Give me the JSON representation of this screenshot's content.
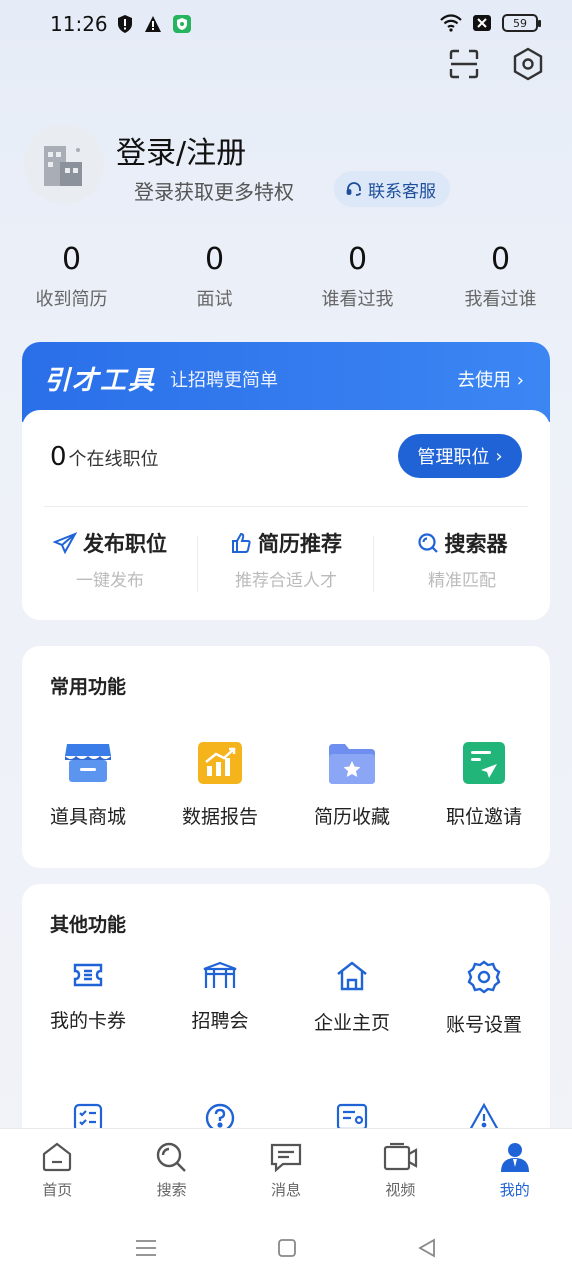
{
  "status_bar": {
    "time": "11:26",
    "battery": "59"
  },
  "profile": {
    "title": "登录/注册",
    "subtitle": "登录获取更多特权",
    "service_label": "联系客服"
  },
  "stats": [
    {
      "value": "0",
      "label": "收到简历"
    },
    {
      "value": "0",
      "label": "面试"
    },
    {
      "value": "0",
      "label": "谁看过我"
    },
    {
      "value": "0",
      "label": "我看过谁"
    }
  ],
  "tools": {
    "logo": "引才工具",
    "slogan": "让招聘更简单",
    "use_label": "去使用",
    "online_count": "0",
    "online_label": "个在线职位",
    "manage_label": "管理职位",
    "quick": [
      {
        "title": "发布职位",
        "desc": "一键发布",
        "icon": "send-icon"
      },
      {
        "title": "简历推荐",
        "desc": "推荐合适人才",
        "icon": "thumbs-up-icon"
      },
      {
        "title": "搜索器",
        "desc": "精准匹配",
        "icon": "search-icon"
      }
    ]
  },
  "common": {
    "title": "常用功能",
    "items": [
      {
        "label": "道具商城",
        "icon": "store-icon",
        "color": "#3b7de8"
      },
      {
        "label": "数据报告",
        "icon": "chart-icon",
        "color": "#f5b31c"
      },
      {
        "label": "简历收藏",
        "icon": "folder-star-icon",
        "color": "#6f8ff0"
      },
      {
        "label": "职位邀请",
        "icon": "invite-icon",
        "color": "#22b57a"
      }
    ]
  },
  "other": {
    "title": "其他功能",
    "items": [
      {
        "label": "我的卡券",
        "icon": "ticket-icon"
      },
      {
        "label": "招聘会",
        "icon": "pavilion-icon"
      },
      {
        "label": "企业主页",
        "icon": "home-icon"
      },
      {
        "label": "账号设置",
        "icon": "gear-icon"
      }
    ]
  },
  "tabbar": [
    {
      "label": "首页",
      "icon": "home-tab-icon"
    },
    {
      "label": "搜索",
      "icon": "search-tab-icon"
    },
    {
      "label": "消息",
      "icon": "message-icon"
    },
    {
      "label": "视频",
      "icon": "video-icon"
    },
    {
      "label": "我的",
      "icon": "profile-icon",
      "active": true
    }
  ],
  "colors": {
    "accent": "#1f63d6",
    "header_blue": "#2a6fe8"
  }
}
